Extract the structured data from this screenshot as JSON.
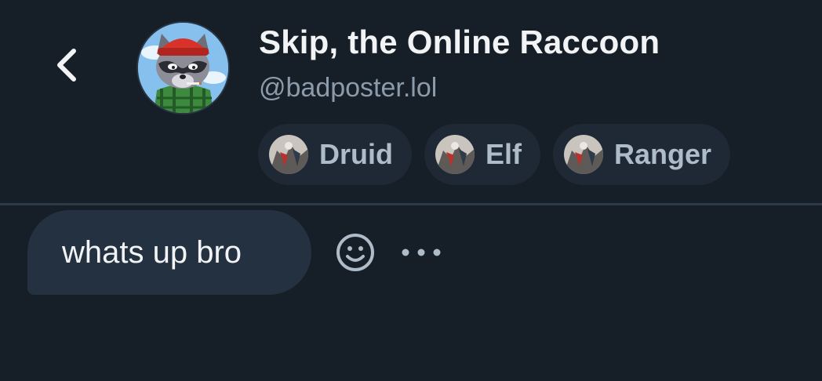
{
  "header": {
    "back_icon": "chevron-left-icon",
    "display_name": "Skip, the Online Raccoon",
    "handle": "@badposter.lol",
    "labels": [
      {
        "label": "Druid",
        "icon": "labeler-avatar-icon"
      },
      {
        "label": "Elf",
        "icon": "labeler-avatar-icon"
      },
      {
        "label": "Ranger",
        "icon": "labeler-avatar-icon"
      }
    ]
  },
  "conversation": {
    "messages": [
      {
        "text": "whats up bro"
      }
    ],
    "react_icon": "smiley-icon",
    "more_icon": "ellipsis-icon"
  },
  "colors": {
    "background": "#161e27",
    "chip_background": "#1e2935",
    "bubble_background": "#243140",
    "divider": "#2c3946",
    "primary_text": "#f1f3f5",
    "secondary_text": "#8c9bab"
  }
}
